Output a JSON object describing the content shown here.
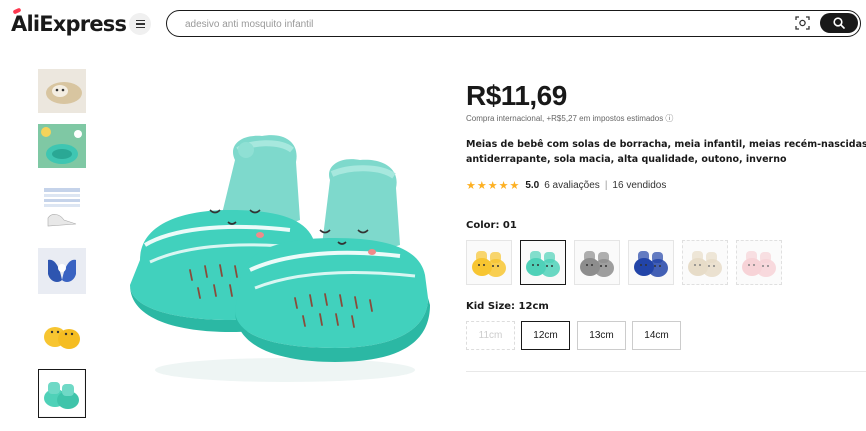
{
  "header": {
    "logo": "AliExpress",
    "search_placeholder": "adesivo anti mosquito infantil"
  },
  "product": {
    "price": "R$11,69",
    "tax_note": "Compra internacional, +R$5,27 em impostos estimados ⓘ",
    "title_line1": "Meias de bebê com solas de borracha, meia infantil, meias recém-nascidas, sa",
    "title_line2": "antiderrapante, sola macia, alta qualidade, outono, inverno",
    "stars": "★★★★★",
    "score": "5.0",
    "reviews": "6 avaliações",
    "separator": "|",
    "sold": "16 vendidos"
  },
  "color": {
    "label": "Color: 01",
    "options": [
      {
        "name": "yellow",
        "color": "#f7c531"
      },
      {
        "name": "mint",
        "color": "#4fd1b8"
      },
      {
        "name": "grey",
        "color": "#8d8d8d"
      },
      {
        "name": "blue",
        "color": "#2244a8"
      },
      {
        "name": "beige",
        "color": "#d8c6a4"
      },
      {
        "name": "pink",
        "color": "#f2b6bd"
      }
    ],
    "selected_index": 1
  },
  "size": {
    "label": "Kid Size: 12cm",
    "options": [
      "11cm",
      "12cm",
      "13cm",
      "14cm"
    ],
    "selected_index": 1
  },
  "thumbnails": [
    {
      "name": "thumb-beige",
      "color": "#d9c9a8"
    },
    {
      "name": "thumb-mint-sole",
      "color": "#40c4b0"
    },
    {
      "name": "thumb-size-chart",
      "color": "#c9d8ee"
    },
    {
      "name": "thumb-blue",
      "color": "#3a5ea8"
    },
    {
      "name": "thumb-yellow",
      "color": "#f7c531"
    },
    {
      "name": "thumb-mint",
      "color": "#4fd1b8"
    }
  ]
}
